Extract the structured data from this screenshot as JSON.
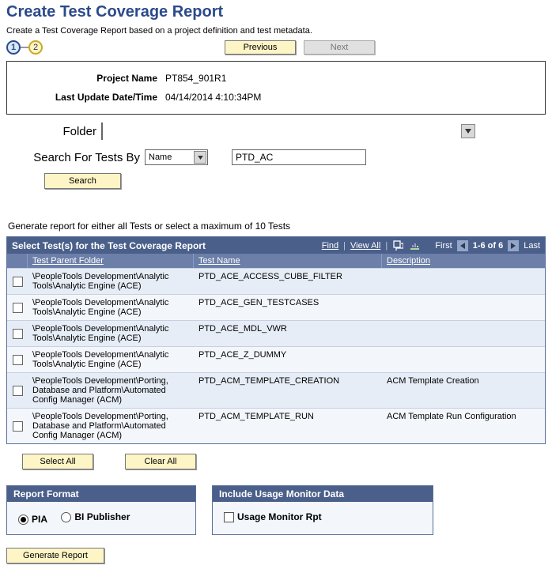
{
  "page": {
    "title": "Create Test Coverage Report",
    "subtitle": "Create a Test Coverage Report based on a project definition and test metadata."
  },
  "wizard": {
    "step1": "1",
    "step2": "2",
    "prev": "Previous",
    "next": "Next"
  },
  "info": {
    "project_label": "Project Name",
    "project_value": "PT854_901R1",
    "updated_label": "Last Update Date/Time",
    "updated_value": "04/14/2014  4:10:34PM"
  },
  "search": {
    "folder_label": "Folder",
    "folder_value": "",
    "by_label": "Search For Tests By",
    "by_value": "Name",
    "term": "PTD_AC",
    "search_btn": "Search"
  },
  "report_hint": "Generate report for either all Tests or select a maximum of 10 Tests",
  "grid": {
    "title": "Select Test(s) for the Test Coverage Report",
    "find": "Find",
    "view_all": "View All",
    "first": "First",
    "range": "1-6 of 6",
    "last": "Last",
    "cols": {
      "parent": "Test Parent Folder",
      "name": "Test Name",
      "desc": "Description"
    },
    "rows": [
      {
        "parent": "\\PeopleTools Development\\Analytic Tools\\Analytic Engine (ACE)",
        "name": "PTD_ACE_ACCESS_CUBE_FILTER",
        "desc": ""
      },
      {
        "parent": "\\PeopleTools Development\\Analytic Tools\\Analytic Engine (ACE)",
        "name": "PTD_ACE_GEN_TESTCASES",
        "desc": ""
      },
      {
        "parent": "\\PeopleTools Development\\Analytic Tools\\Analytic Engine (ACE)",
        "name": "PTD_ACE_MDL_VWR",
        "desc": ""
      },
      {
        "parent": "\\PeopleTools Development\\Analytic Tools\\Analytic Engine (ACE)",
        "name": "PTD_ACE_Z_DUMMY",
        "desc": ""
      },
      {
        "parent": "\\PeopleTools Development\\Porting, Database and Platform\\Automated Config Manager (ACM)",
        "name": "PTD_ACM_TEMPLATE_CREATION",
        "desc": "ACM Template Creation"
      },
      {
        "parent": "\\PeopleTools Development\\Porting, Database and Platform\\Automated Config Manager (ACM)",
        "name": "PTD_ACM_TEMPLATE_RUN",
        "desc": "ACM Template Run Configuration"
      }
    ]
  },
  "buttons": {
    "select_all": "Select All",
    "clear_all": "Clear All",
    "generate": "Generate Report"
  },
  "panels": {
    "format": {
      "title": "Report Format",
      "pia": "PIA",
      "bi": "BI Publisher"
    },
    "usage": {
      "title": "Include Usage Monitor Data",
      "label": "Usage Monitor Rpt"
    }
  }
}
